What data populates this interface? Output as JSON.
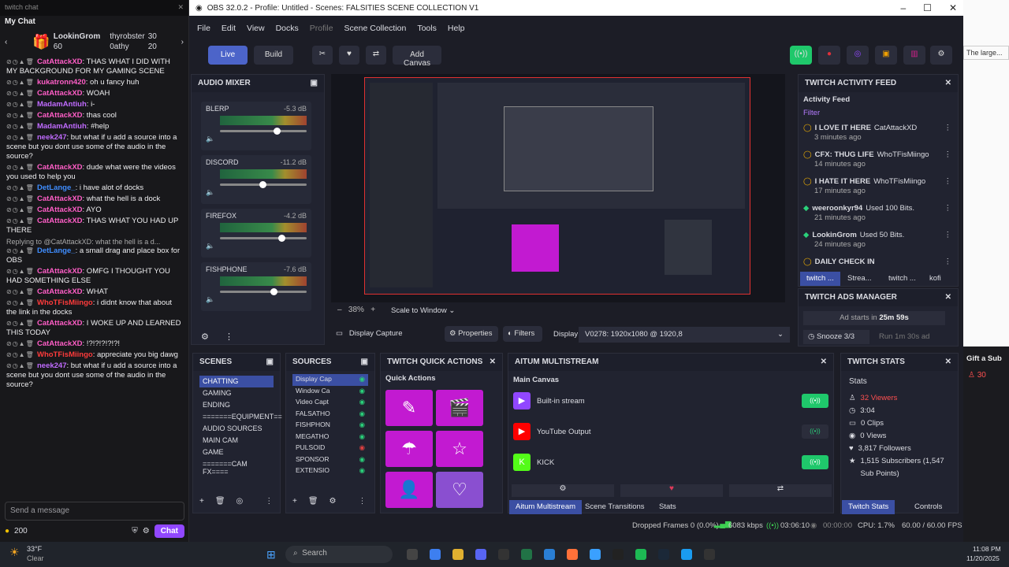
{
  "chat": {
    "window_title": "twitch chat",
    "header": "My Chat",
    "gift1": {
      "name": "LookinGrom",
      "count": "60"
    },
    "gift2": {
      "name": "thyrobster",
      "count": "30"
    },
    "gift3": {
      "name": "0athy",
      "count": "20"
    },
    "messages": [
      {
        "user": "CatAttackXD",
        "text": ": THAS WHAT I DID WITH MY BACKGROUND FOR MY GAMING SCENE",
        "color": "#ff5ec7"
      },
      {
        "user": "kukatronn420",
        "text": ": oh u fancy huh",
        "color": "#ff5ec7"
      },
      {
        "user": "CatAttackXD",
        "text": ": WOAH",
        "color": "#ff5ec7"
      },
      {
        "user": "MadamAntiuh",
        "text": ": i-",
        "color": "#c06bff"
      },
      {
        "user": "CatAttackXD",
        "text": ": thas cool",
        "color": "#ff5ec7"
      },
      {
        "user": "MadamAntiuh",
        "text": ": #help",
        "color": "#c06bff"
      },
      {
        "user": "neek247",
        "text": ": but what if u add a source into a scene but you dont use some of the audio in the source?",
        "color": "#c06bff"
      },
      {
        "user": "CatAttackXD",
        "text": ": dude what were the videos you used to help you",
        "color": "#ff5ec7"
      },
      {
        "user": "DetLange_",
        "text": ": i have alot of docks",
        "color": "#3f8dff"
      },
      {
        "user": "CatAttackXD",
        "text": ": what the hell is a dock",
        "color": "#ff5ec7"
      },
      {
        "user": "CatAttackXD",
        "text": ": AYO",
        "color": "#ff5ec7"
      },
      {
        "user": "CatAttackXD",
        "text": ": THAS WHAT YOU HAD UP THERE",
        "color": "#ff5ec7"
      },
      {
        "user": "DetLange_",
        "text": ": a small drag and place box for OBS",
        "color": "#3f8dff",
        "reply": "Replying to @CatAttackXD: what the hell is a d..."
      },
      {
        "user": "CatAttackXD",
        "text": ": OMFG I THOUGHT YOU HAD SOMETHING ELSE",
        "color": "#ff5ec7"
      },
      {
        "user": "CatAttackXD",
        "text": ": WHAT",
        "color": "#ff5ec7"
      },
      {
        "user": "WhoTFisMiingo",
        "text": ": i didnt know that about the link in the docks",
        "color": "#ff3b3b"
      },
      {
        "user": "CatAttackXD",
        "text": ": I WOKE UP AND LEARNED THIS TODAY",
        "color": "#ff5ec7"
      },
      {
        "user": "CatAttackXD",
        "text": ": !?!?!?!?!?!",
        "color": "#ff5ec7"
      },
      {
        "user": "WhoTFisMiingo",
        "text": ": appreciate you big dawg",
        "color": "#ff3b3b"
      },
      {
        "user": "neek247",
        "text": ": but what if u add a source into a scene but you dont use some of the audio in the source?",
        "color": "#c06bff"
      }
    ],
    "input_placeholder": "Send a message",
    "points": "200",
    "chat_button": "Chat"
  },
  "obs": {
    "title": "OBS 32.0.2 - Profile: Untitled - Scenes: FALSITIES SCENE COLLECTION V1",
    "menu": [
      "File",
      "Edit",
      "View",
      "Docks",
      "Profile",
      "Scene Collection",
      "Tools",
      "Help"
    ],
    "live": "Live",
    "build": "Build",
    "add_canvas": "Add Canvas",
    "audio_mixer": "AUDIO MIXER",
    "channels": [
      {
        "name": "BLERP",
        "db": "-5.3 dB",
        "level": 0.62
      },
      {
        "name": "DISCORD",
        "db": "-11.2 dB",
        "level": 0.45
      },
      {
        "name": "FIREFOX",
        "db": "-4.2 dB",
        "level": 0.67
      },
      {
        "name": "FISHPHONE",
        "db": "-7.6 dB",
        "level": 0.58
      }
    ],
    "zoom": "38%",
    "scale": "Scale to Window",
    "source_name": "Display Capture",
    "properties": "Properties",
    "filters": "Filters",
    "display_label": "Display",
    "display_value": "V0278: 1920x1080 @ 1920,8",
    "scenes_title": "SCENES",
    "scenes": [
      "CHATTING",
      "GAMING",
      "ENDING",
      "=======EQUIPMENT==",
      "AUDIO SOURCES",
      "MAIN CAM",
      "GAME",
      "=======CAM FX===="
    ],
    "sources_title": "SOURCES",
    "sources": [
      "Display Cap",
      "Window Ca",
      "Video Capt",
      "FALSATHO",
      "FISHPHON",
      "MEGATHO",
      "PULSOID",
      "SPONSOR",
      "EXTENSIO"
    ],
    "quick_title": "TWITCH QUICK ACTIONS",
    "quick_sub": "Quick Actions",
    "multistream_title": "AITUM MULTISTREAM",
    "main_canvas": "Main Canvas",
    "outputs": [
      {
        "name": "Built-in stream",
        "active": true
      },
      {
        "name": "YouTube Output",
        "active": false
      },
      {
        "name": "KICK",
        "active": true
      }
    ],
    "bottom_tabs": [
      "Aitum Multistream",
      "Scene Transitions",
      "Stats"
    ],
    "feed_title": "TWITCH ACTIVITY FEED",
    "feed_sub": "Activity Feed",
    "filter": "Filter",
    "feed": [
      {
        "t": "I LOVE IT HERE",
        "u": "CatAttackXD",
        "m": "3 minutes ago"
      },
      {
        "t": "CFX: THUG LIFE",
        "u": "WhoTFisMiingo",
        "m": "14 minutes ago"
      },
      {
        "t": "I HATE IT HERE",
        "u": "WhoTFisMiingo",
        "m": "17 minutes ago"
      },
      {
        "t": "weeroonkyr94",
        "u": "Used 100 Bits.",
        "m": "21 minutes ago"
      },
      {
        "t": "LookinGrom",
        "u": "Used 50 Bits.",
        "m": "24 minutes ago"
      },
      {
        "t": "DAILY CHECK IN",
        "u": "",
        "m": ""
      }
    ],
    "feed_tabs": [
      "twitch ...",
      "Strea...",
      "twitch ...",
      "kofi"
    ],
    "ads_title": "TWITCH ADS MANAGER",
    "ad_text": "Ad starts in",
    "ad_time": "25m 59s",
    "snooze": "Snooze 3/3",
    "run": "Run 1m 30s ad",
    "stats_title": "TWITCH STATS",
    "stats_sub": "Stats",
    "stats": [
      "32 Viewers",
      "3:04",
      "0 Clips",
      "0 Views",
      "3,817 Followers",
      "1,515 Subscribers (1,547 Sub Points)"
    ],
    "stats_tabs": [
      "Twitch Stats",
      "Controls"
    ],
    "status": {
      "dropped": "Dropped Frames 0 (0.0%)",
      "kbps": "6083 kbps",
      "live_time": "03:06:10",
      "rec_time": "00:00:00",
      "cpu": "CPU: 1.7%",
      "fps": "60.00 / 60.00 FPS"
    }
  },
  "side": {
    "tab_title": "The large...",
    "gift": "Gift a Sub",
    "count": "30"
  },
  "taskbar": {
    "temp": "33°F",
    "weather": "Clear",
    "search": "Search",
    "time": "11:08 PM",
    "date": "11/20/2025"
  }
}
